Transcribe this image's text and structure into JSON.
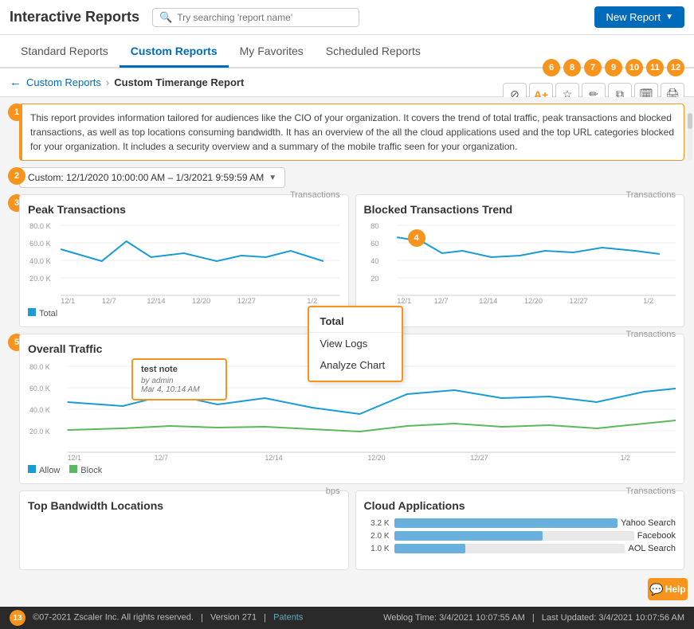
{
  "header": {
    "title": "Interactive Reports",
    "search_placeholder": "Try searching 'report name'",
    "new_report_label": "New Report"
  },
  "nav": {
    "tabs": [
      {
        "id": "standard",
        "label": "Standard Reports",
        "active": false
      },
      {
        "id": "custom",
        "label": "Custom Reports",
        "active": true
      },
      {
        "id": "favorites",
        "label": "My Favorites",
        "active": false
      },
      {
        "id": "scheduled",
        "label": "Scheduled Reports",
        "active": false
      }
    ]
  },
  "breadcrumb": {
    "back_label": "←",
    "parent": "Custom Reports",
    "separator": "›",
    "current": "Custom Timerange Report"
  },
  "toolbar": {
    "icons": [
      {
        "id": "hide",
        "num": "6",
        "symbol": "⊘"
      },
      {
        "id": "annotate",
        "num": "8",
        "symbol": "✏"
      },
      {
        "id": "star",
        "num": "7",
        "symbol": "☆"
      },
      {
        "id": "edit",
        "num": "9",
        "symbol": "✎"
      },
      {
        "id": "copy",
        "num": "10",
        "symbol": "⧉"
      },
      {
        "id": "calendar",
        "num": "11",
        "symbol": "📅"
      },
      {
        "id": "print",
        "num": "12",
        "symbol": "🖨"
      }
    ]
  },
  "description": {
    "num": "1",
    "text": "This report provides information tailored for audiences like the CIO of your organization. It covers the trend of total traffic, peak transactions and blocked transactions, as well as top locations consuming bandwidth. It has an overview of the all the cloud applications used and the top URL categories blocked for your organization. It includes a security overview and a summary of the mobile traffic seen for your organization."
  },
  "date_range": {
    "num": "2",
    "value": "Custom: 12/1/2020 10:00:00 AM – 1/3/2021 9:59:59 AM"
  },
  "section3": {
    "num": "3"
  },
  "chart_peak": {
    "title": "Peak Transactions",
    "unit": "Transactions",
    "legend": [
      {
        "color": "#1a9bd7",
        "label": "Total"
      }
    ],
    "y_labels": [
      "80.0 K",
      "60.0 K",
      "40.0 K",
      "20.0 K"
    ],
    "x_labels": [
      "12/1",
      "12/7",
      "12/14",
      "12/20",
      "12/27",
      "1/2"
    ]
  },
  "chart_blocked": {
    "title": "Blocked Transactions Trend",
    "unit": "Transactions",
    "legend": [
      {
        "color": "#1a9bd7",
        "label": "Total"
      }
    ],
    "y_labels": [
      "80",
      "60",
      "40",
      "20"
    ],
    "x_labels": [
      "12/1",
      "12/7",
      "12/14",
      "12/20",
      "12/27",
      "1/2"
    ]
  },
  "context_menu": {
    "num": "4",
    "title": "Total",
    "items": [
      "View Logs",
      "Analyze Chart"
    ]
  },
  "chart_overall": {
    "num": "5",
    "title": "Overall Traffic",
    "unit": "Transactions",
    "legend": [
      {
        "color": "#1a9bd7",
        "label": "Allow"
      },
      {
        "color": "#5cb85c",
        "label": "Block"
      }
    ],
    "y_labels": [
      "80.0 K",
      "60.0 K",
      "40.0 K",
      "20.0 K"
    ],
    "x_labels": [
      "12/1",
      "12/7",
      "12/14",
      "12/20",
      "12/27",
      "1/2"
    ],
    "note": {
      "title": "test note",
      "by": "by admin",
      "date": "Mar 4, 10:14 AM"
    }
  },
  "chart_bandwidth": {
    "title": "Top Bandwidth Locations",
    "unit": "bps"
  },
  "chart_cloud": {
    "title": "Cloud Applications",
    "unit": "Transactions",
    "bars": [
      {
        "val": "3.2 K",
        "label": "Yahoo Search",
        "pct": 100
      },
      {
        "val": "2.0 K",
        "label": "Facebook",
        "pct": 62
      },
      {
        "val": "1.0 K",
        "label": "AOL Search",
        "pct": 31
      }
    ]
  },
  "footer": {
    "num": "13",
    "copyright": "©07-2021 Zscaler Inc. All rights reserved.",
    "version": "Version 271",
    "patents": "Patents",
    "weblog_time": "Weblog Time: 3/4/2021 10:07:55 AM",
    "last_updated": "Last Updated: 3/4/2021 10:07:56 AM"
  },
  "help_label": "Help"
}
